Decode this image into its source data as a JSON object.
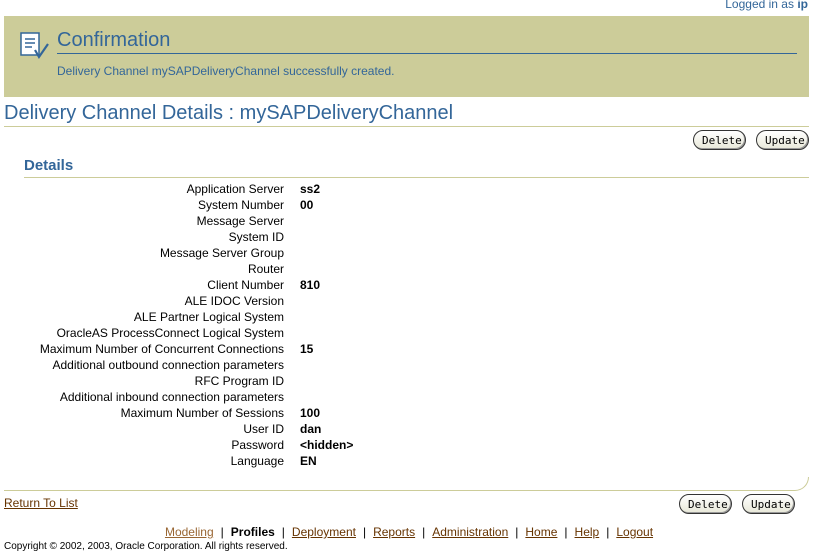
{
  "header": {
    "logged_in_prefix": "Logged in as",
    "user": "ip"
  },
  "confirmation": {
    "title": "Confirmation",
    "message": "Delivery Channel mySAPDeliveryChannel successfully created.",
    "icon": "info-document-icon"
  },
  "page": {
    "title": "Delivery Channel Details : mySAPDeliveryChannel"
  },
  "buttons": {
    "delete": "Delete",
    "update": "Update"
  },
  "details": {
    "section_title": "Details",
    "rows": [
      {
        "label": "Application Server",
        "value": "ss2"
      },
      {
        "label": "System Number",
        "value": "00"
      },
      {
        "label": "Message Server",
        "value": ""
      },
      {
        "label": "System ID",
        "value": ""
      },
      {
        "label": "Message Server Group",
        "value": ""
      },
      {
        "label": "Router",
        "value": ""
      },
      {
        "label": "Client Number",
        "value": "810"
      },
      {
        "label": "ALE IDOC Version",
        "value": ""
      },
      {
        "label": "ALE Partner Logical System",
        "value": ""
      },
      {
        "label": "OracleAS ProcessConnect Logical System",
        "value": ""
      },
      {
        "label": "Maximum Number of Concurrent Connections",
        "value": "15"
      },
      {
        "label": "Additional outbound connection parameters",
        "value": ""
      },
      {
        "label": "RFC Program ID",
        "value": ""
      },
      {
        "label": "Additional inbound connection parameters",
        "value": ""
      },
      {
        "label": "Maximum Number of Sessions",
        "value": "100"
      },
      {
        "label": "User ID",
        "value": "dan"
      },
      {
        "label": "Password",
        "value": "<hidden>"
      },
      {
        "label": "Language",
        "value": "EN"
      }
    ]
  },
  "return_link": "Return To List",
  "footer": {
    "nav": [
      "Modeling",
      "Profiles",
      "Deployment",
      "Reports",
      "Administration",
      "Home",
      "Help",
      "Logout"
    ],
    "current": "Profiles",
    "copyright": "Copyright © 2002, 2003, Oracle Corporation. All rights reserved."
  },
  "colors": {
    "banner": "#cccc99",
    "heading": "#336699",
    "link": "#663300"
  }
}
